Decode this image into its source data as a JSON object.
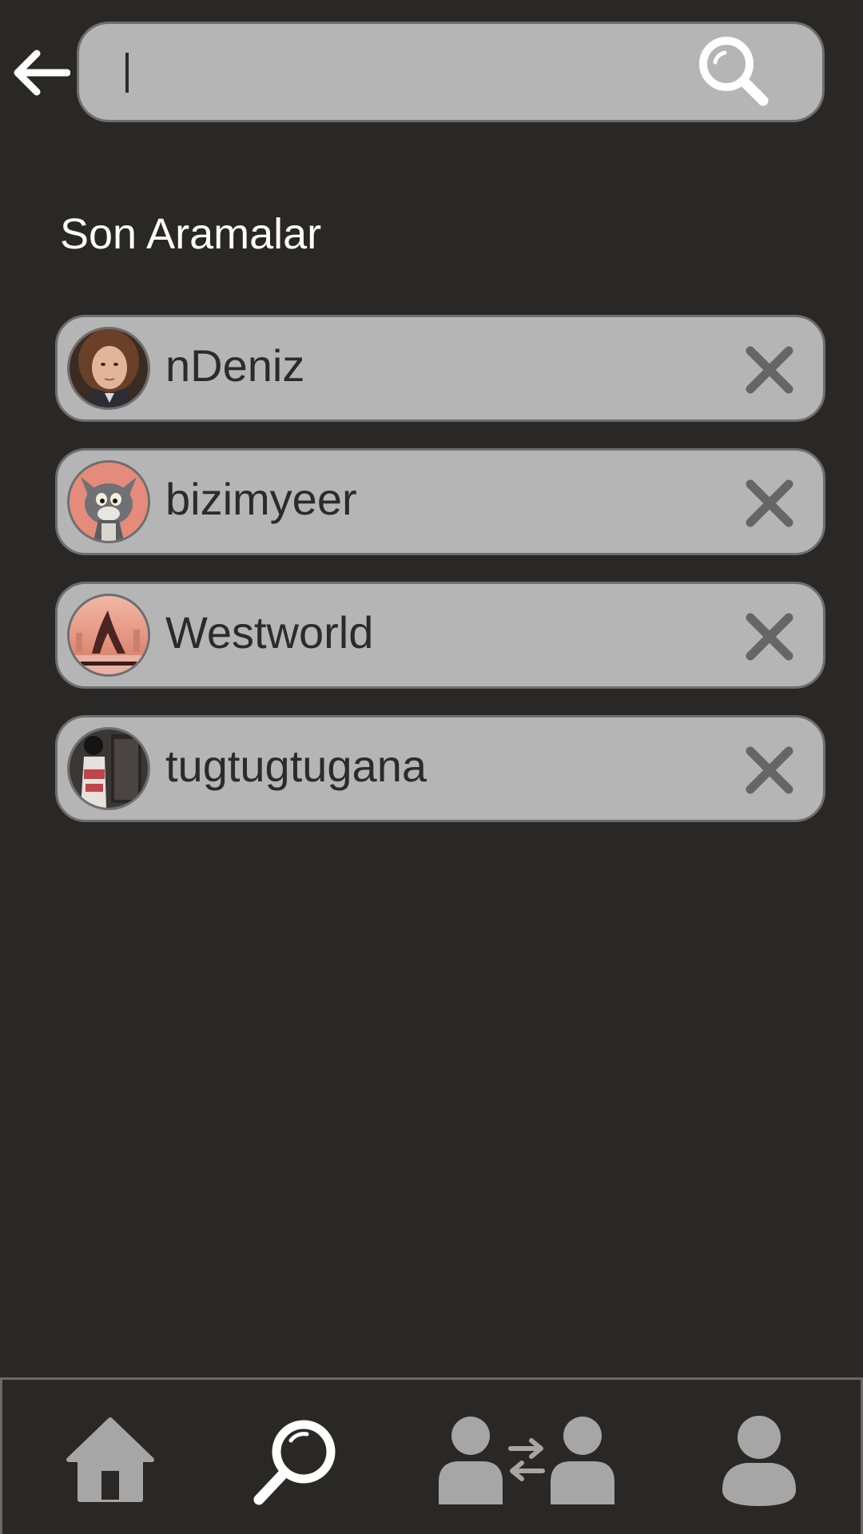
{
  "search": {
    "placeholder": "",
    "value": ""
  },
  "recent": {
    "title": "Son Aramalar",
    "items": [
      {
        "label": "nDeniz",
        "avatar": "girl-portrait-avatar"
      },
      {
        "label": "bizimyeer",
        "avatar": "cartoon-cat-avatar"
      },
      {
        "label": "Westworld",
        "avatar": "westworld-poster-avatar"
      },
      {
        "label": "tugtugtugana",
        "avatar": "person-in-doorway-avatar"
      }
    ]
  },
  "nav": {
    "items": [
      {
        "name": "home",
        "icon": "home-icon",
        "active": false
      },
      {
        "name": "search",
        "icon": "search-icon",
        "active": true
      },
      {
        "name": "follow",
        "icon": "users-exchange-icon",
        "active": false
      },
      {
        "name": "profile",
        "icon": "user-icon",
        "active": false
      }
    ]
  },
  "colors": {
    "background": "#292827",
    "field": "#b5b5b5",
    "field_border": "#6e6e6e",
    "text_dark": "#2b2b2b",
    "text_light": "#ffffff",
    "icon_gray": "#666666",
    "nav_inactive": "#a6a6a6",
    "nav_active": "#ffffff"
  }
}
